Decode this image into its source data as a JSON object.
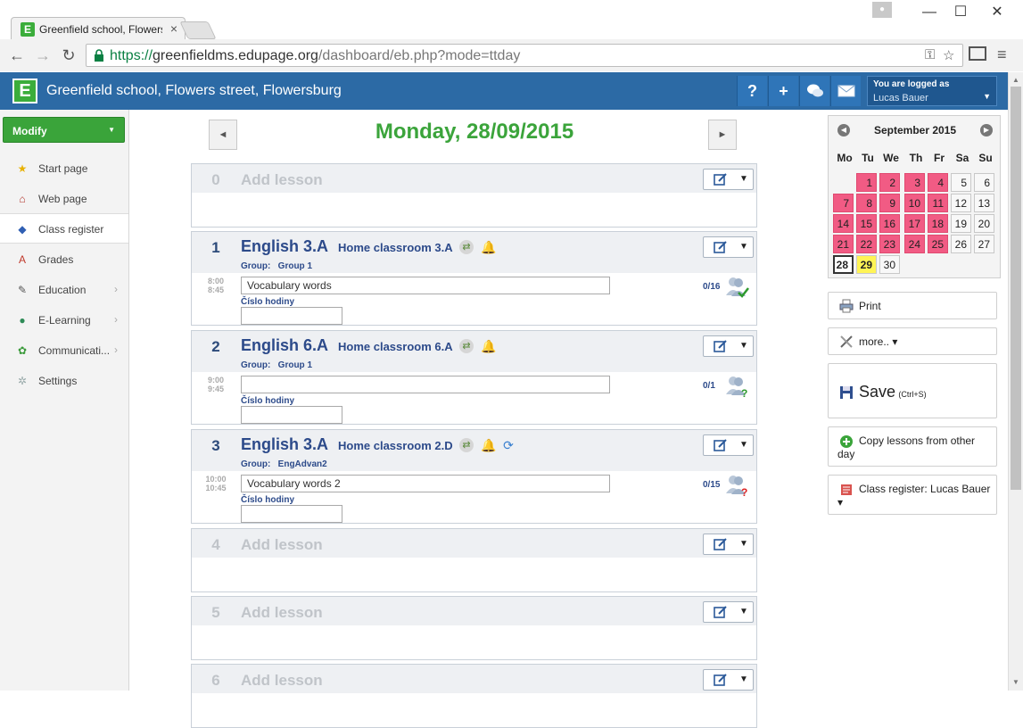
{
  "browser": {
    "tab_title": "Greenfield school, Flowers",
    "tab_icon": "E",
    "close_glyph": "×",
    "url_scheme": "https://",
    "url_host": "greenfieldms.edupage.org",
    "url_path": "/dashboard/eb.php?mode=ttday",
    "minimize_glyph": "—",
    "maximize_glyph": "☐",
    "close_window_glyph": "✕"
  },
  "header": {
    "logo_letter": "E",
    "school_title": "Greenfield school, Flowers street, Flowersburg",
    "help_label": "?",
    "add_label": "+",
    "logged_caption": "You are logged as",
    "user_name": "Lucas Bauer"
  },
  "sidebar": {
    "modify_label": "Modify",
    "items": [
      {
        "label": "Start page",
        "icon": "star-icon",
        "glyph": "★",
        "color": "#e8b100",
        "chevron": false
      },
      {
        "label": "Web page",
        "icon": "house-icon",
        "glyph": "⌂",
        "color": "#b2342b",
        "chevron": false
      },
      {
        "label": "Class register",
        "icon": "book-icon",
        "glyph": "◆",
        "color": "#2f5fb3",
        "chevron": false
      },
      {
        "label": "Grades",
        "icon": "grades-icon",
        "glyph": "A",
        "color": "#c0392b",
        "chevron": false
      },
      {
        "label": "Education",
        "icon": "education-icon",
        "glyph": "✎",
        "color": "#555",
        "chevron": true
      },
      {
        "label": "E-Learning",
        "icon": "e-learning-icon",
        "glyph": "●",
        "color": "#2e8b57",
        "chevron": true
      },
      {
        "label": "Communicati...",
        "icon": "communication-icon",
        "glyph": "✿",
        "color": "#3a9a3a",
        "chevron": true
      },
      {
        "label": "Settings",
        "icon": "settings-icon",
        "glyph": "✲",
        "color": "#9aa",
        "chevron": false
      }
    ],
    "chevron_glyph": "›"
  },
  "main": {
    "day_title": "Monday, 28/09/2015",
    "prev_glyph": "◄",
    "next_glyph": "►",
    "add_lesson_label": "Add lesson",
    "group_prefix": "Group:",
    "hour_label": "Číslo hodiny",
    "lessons": [
      {
        "num": "0",
        "empty": true
      },
      {
        "num": "1",
        "empty": false,
        "subject": "English",
        "class_name": "3.A",
        "classroom": "Home classroom 3.A",
        "group": "Group 1",
        "time_start": "8:00",
        "time_end": "8:45",
        "topic": "Vocabulary words",
        "attendance": "0/16",
        "status": "ok",
        "sync": false
      },
      {
        "num": "2",
        "empty": false,
        "subject": "English",
        "class_name": "6.A",
        "classroom": "Home classroom 6.A",
        "group": "Group 1",
        "time_start": "9:00",
        "time_end": "9:45",
        "topic": "",
        "attendance": "0/1",
        "status": "unknown",
        "sync": false
      },
      {
        "num": "3",
        "empty": false,
        "subject": "English",
        "class_name": "3.A",
        "classroom": "Home classroom 2.D",
        "group": "EngAdvan2",
        "time_start": "10:00",
        "time_end": "10:45",
        "topic": "Vocabulary words 2",
        "attendance": "0/15",
        "status": "missing",
        "sync": true
      },
      {
        "num": "4",
        "empty": true
      },
      {
        "num": "5",
        "empty": true
      },
      {
        "num": "6",
        "empty": true
      }
    ]
  },
  "calendar": {
    "title": "September 2015",
    "weekdays": [
      "Mo",
      "Tu",
      "We",
      "Th",
      "Fr",
      "Sa",
      "Su"
    ],
    "days": [
      {
        "d": "1",
        "state": "busy"
      },
      {
        "d": "2",
        "state": "busy"
      },
      {
        "d": "3",
        "state": "busy"
      },
      {
        "d": "4",
        "state": "busy"
      },
      {
        "d": "5",
        "state": ""
      },
      {
        "d": "6",
        "state": ""
      },
      {
        "d": "7",
        "state": "busy"
      },
      {
        "d": "8",
        "state": "busy"
      },
      {
        "d": "9",
        "state": "busy"
      },
      {
        "d": "10",
        "state": "busy"
      },
      {
        "d": "11",
        "state": "busy"
      },
      {
        "d": "12",
        "state": ""
      },
      {
        "d": "13",
        "state": ""
      },
      {
        "d": "14",
        "state": "busy"
      },
      {
        "d": "15",
        "state": "busy"
      },
      {
        "d": "16",
        "state": "busy"
      },
      {
        "d": "17",
        "state": "busy"
      },
      {
        "d": "18",
        "state": "busy"
      },
      {
        "d": "19",
        "state": ""
      },
      {
        "d": "20",
        "state": ""
      },
      {
        "d": "21",
        "state": "busy"
      },
      {
        "d": "22",
        "state": "busy"
      },
      {
        "d": "23",
        "state": "busy"
      },
      {
        "d": "24",
        "state": "busy"
      },
      {
        "d": "25",
        "state": "busy"
      },
      {
        "d": "26",
        "state": ""
      },
      {
        "d": "27",
        "state": ""
      },
      {
        "d": "28",
        "state": "today"
      },
      {
        "d": "29",
        "state": "sel"
      },
      {
        "d": "30",
        "state": ""
      }
    ],
    "first_weekday_offset": 1
  },
  "actions": {
    "print_label": "Print",
    "more_label": "more.. ▾",
    "save_label": "Save",
    "save_hint": "(Ctrl+S)",
    "copy_label": "Copy lessons from other day",
    "register_label": "Class register: Lucas Bauer ▾"
  },
  "colors": {
    "header_blue": "#2c6aa5",
    "brand_green": "#3ba43b",
    "busy_day": "#f15b84",
    "selected_day": "#fff455"
  }
}
